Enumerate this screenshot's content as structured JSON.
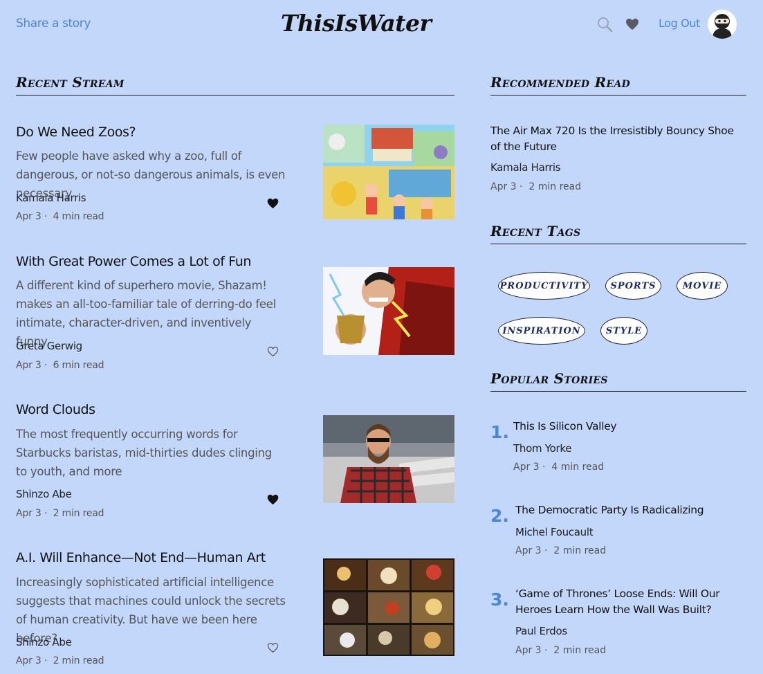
{
  "header": {
    "share_label": "Share a story",
    "logo": "ThisIsWater",
    "logout_label": "Log Out"
  },
  "recent_stream": {
    "title": "Recent Stream",
    "stories": [
      {
        "title": "Do We Need Zoos?",
        "description": "Few people have asked why a zoo, full of dangerous, or not-so dangerous animals, is even necessary",
        "author": "Kamala Harris",
        "date": "Apr 3 ·",
        "read_time": "4 min read",
        "liked": true
      },
      {
        "title": "With Great Power Comes a Lot of Fun",
        "description": "A different kind of superhero movie, Shazam! makes an all-too-familiar tale of derring-do feel intimate, character-driven, and inventively funny",
        "author": "Greta Gerwig",
        "date": "Apr 3 ·",
        "read_time": "6 min read",
        "liked": false
      },
      {
        "title": "Word Clouds",
        "description": "The most frequently occurring words for Starbucks baristas, mid-thirties dudes clinging to youth, and more",
        "author": "Shinzo Abe",
        "date": "Apr 3 ·",
        "read_time": "2 min read",
        "liked": true
      },
      {
        "title": "A.I. Will Enhance—Not End—Human Art",
        "description": "Increasingly sophisticated artificial intelligence suggests that machines could unlock the secrets of human creativity. But have we been here before?",
        "author": "Shinzo Abe",
        "date": "Apr 3 ·",
        "read_time": "2 min read",
        "liked": false
      }
    ]
  },
  "recommended": {
    "title": "Recommended Read",
    "story_title": "The Air Max 720 Is the Irresistibly Bouncy Shoe of the Future",
    "author": "Kamala Harris",
    "date": "Apr 3 ·",
    "read_time": "2 min read"
  },
  "tags": {
    "title": "Recent Tags",
    "items": [
      "productivity",
      "sports",
      "movie",
      "inspiration",
      "style"
    ]
  },
  "popular": {
    "title": "Popular Stories",
    "items": [
      {
        "num": "1.",
        "title": "This Is Silicon Valley",
        "author": "Thom Yorke",
        "date": "Apr 3 ·",
        "read_time": "4 min read"
      },
      {
        "num": "2.",
        "title": "The Democratic Party Is Radicalizing",
        "author": "Michel Foucault",
        "date": "Apr 3 ·",
        "read_time": "2 min read"
      },
      {
        "num": "3.",
        "title": "‘Game of Thrones’ Loose Ends: Will Our Heroes Learn How the Wall Was Built?",
        "author": "Paul Erdos",
        "date": "Apr 3 ·",
        "read_time": "2 min read"
      }
    ]
  },
  "colors": {
    "background": "#c3d7fb",
    "link": "#4d86d6",
    "number": "#4d86d6"
  }
}
